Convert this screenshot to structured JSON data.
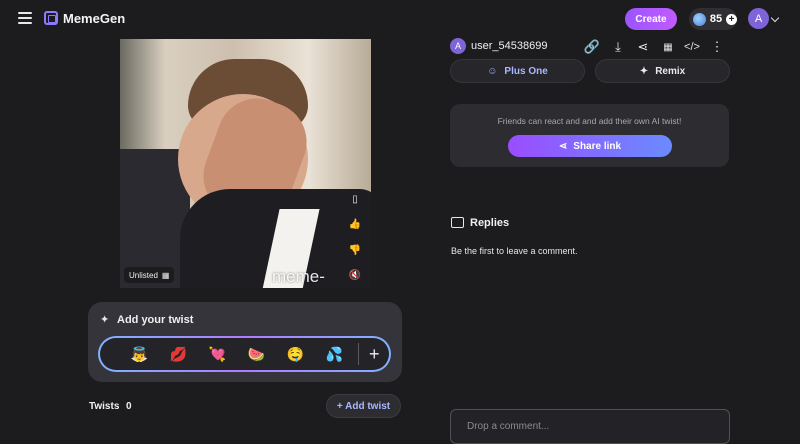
{
  "app": {
    "name": "MemeGen"
  },
  "header": {
    "create_label": "Create",
    "credits": "85",
    "avatar_initial": "A",
    "icons": [
      "menu-icon",
      "logo-icon",
      "coin-icon",
      "plus-icon",
      "chevron-down-icon"
    ]
  },
  "meme": {
    "visibility": "Unlisted",
    "watermark": "meme-gen.ai",
    "side_actions": [
      "bookmark-icon",
      "thumbs-up-icon",
      "thumbs-down-icon",
      "mute-icon"
    ]
  },
  "twist": {
    "title": "Add your twist",
    "emojis": [
      "👼",
      "💋",
      "💘",
      "🍉",
      "🤤",
      "💦"
    ],
    "more_label": "+",
    "count_label": "Twists",
    "count": "0",
    "add_label": "+ Add twist"
  },
  "post": {
    "author_initial": "A",
    "author": "user_54538699",
    "actions": [
      "link-icon",
      "download-icon",
      "share-icon",
      "qr-code-icon",
      "embed-icon",
      "more-icon"
    ],
    "plus_one_label": "Plus One",
    "remix_label": "Remix"
  },
  "share": {
    "text": "Friends can react and and add their own AI twist!",
    "button_label": "Share link"
  },
  "replies": {
    "title": "Replies",
    "empty_text": "Be the first to leave a comment.",
    "input_placeholder": "Drop a comment..."
  },
  "colors": {
    "background": "#1c1c1e",
    "accent_purple": "#9a55ff",
    "accent_blue": "#6a8bff",
    "link_blue": "#a9b8ff"
  }
}
